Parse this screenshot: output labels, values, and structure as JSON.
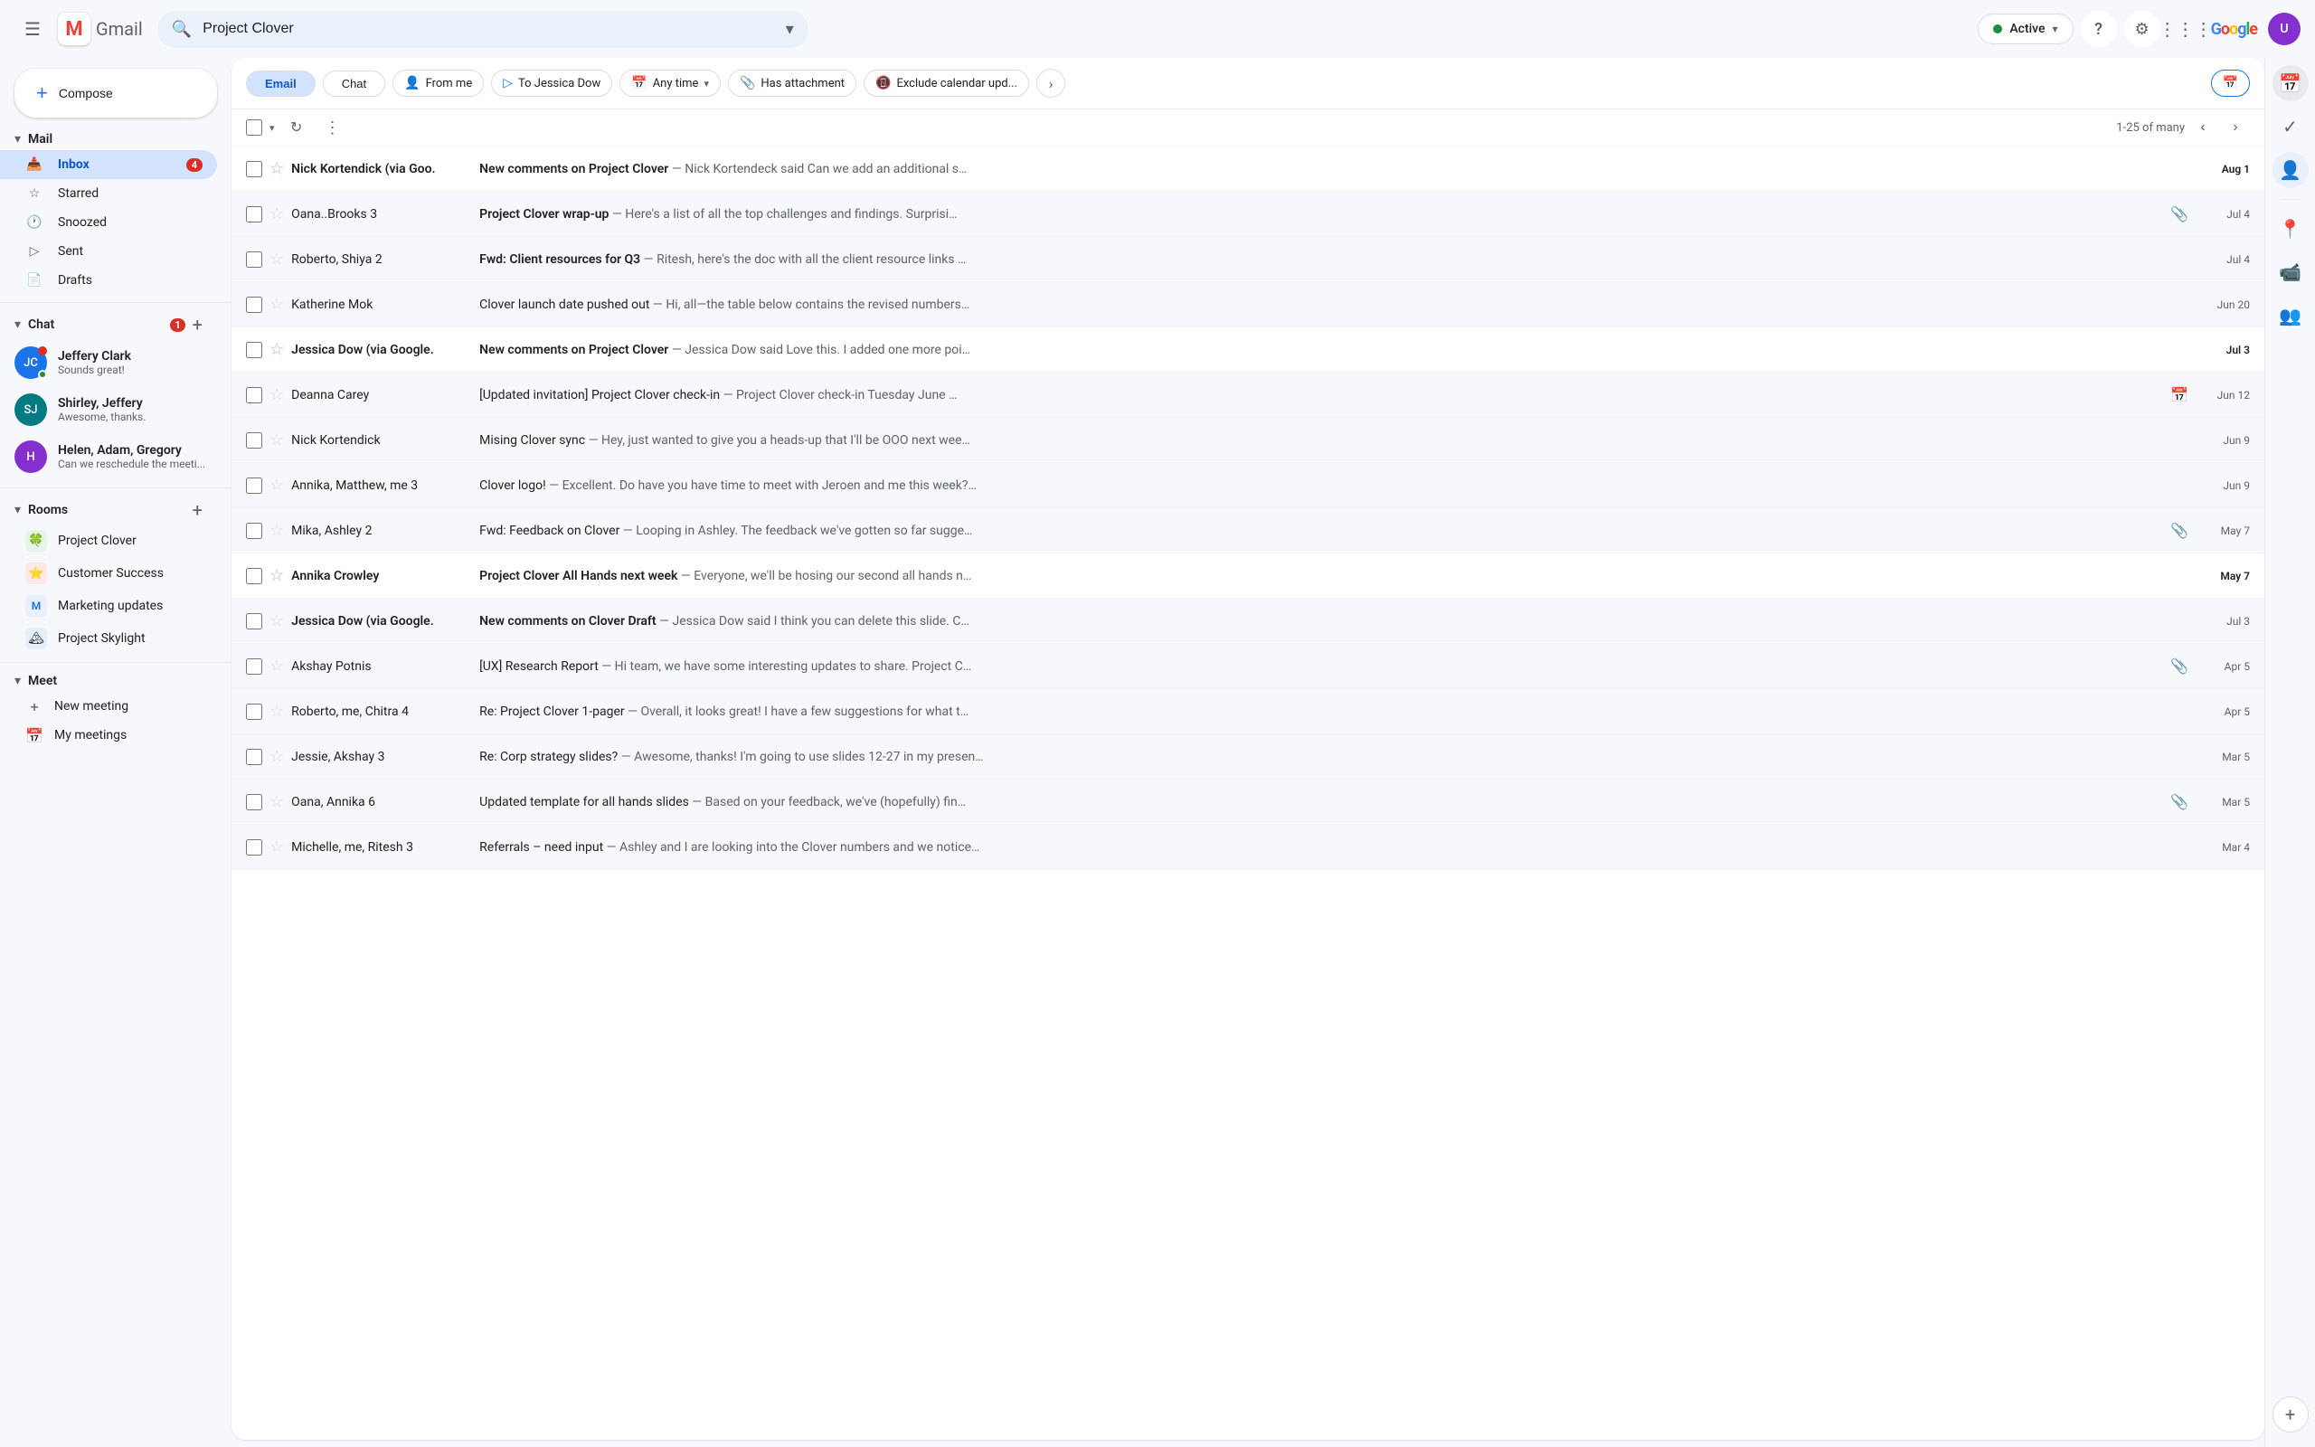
{
  "app": {
    "title": "Gmail",
    "logo_m": "M",
    "logo_text": "Gmail"
  },
  "topbar": {
    "search_placeholder": "Project Clover",
    "status_label": "Active",
    "help_icon": "?",
    "settings_icon": "⚙",
    "apps_icon": "⋮⋮⋮",
    "google_logo": "Google"
  },
  "compose": {
    "label": "Compose",
    "plus": "+"
  },
  "nav": {
    "mail_section": "Mail",
    "mail_items": [
      {
        "id": "inbox",
        "label": "Inbox",
        "badge": "4",
        "icon": "📥"
      },
      {
        "id": "starred",
        "label": "Starred",
        "badge": "",
        "icon": "☆"
      },
      {
        "id": "snoozed",
        "label": "Snoozed",
        "badge": "",
        "icon": "🕐"
      },
      {
        "id": "sent",
        "label": "Sent",
        "badge": "",
        "icon": "▷"
      },
      {
        "id": "drafts",
        "label": "Drafts",
        "badge": "",
        "icon": "📄"
      }
    ],
    "chat_section": "Chat",
    "chat_badge": "1",
    "chat_items": [
      {
        "id": "jeffery",
        "name": "Jeffery Clark",
        "preview": "Sounds great!",
        "online": true,
        "unread": true,
        "initials": "JC",
        "color": "av-blue"
      },
      {
        "id": "shirley",
        "name": "Shirley, Jeffery",
        "preview": "Awesome, thanks.",
        "online": false,
        "unread": false,
        "initials": "SJ",
        "color": "av-teal"
      },
      {
        "id": "helen",
        "name": "Helen, Adam, Gregory",
        "preview": "Can we reschedule the meeti...",
        "online": false,
        "unread": false,
        "initials": "H",
        "color": "av-purple"
      }
    ],
    "rooms_section": "Rooms",
    "rooms": [
      {
        "id": "project-clover",
        "label": "Project Clover",
        "emoji": "🍀"
      },
      {
        "id": "customer-success",
        "label": "Customer Success",
        "emoji": "⭐"
      },
      {
        "id": "marketing-updates",
        "label": "Marketing updates",
        "emoji": "M"
      },
      {
        "id": "project-skylight",
        "label": "Project Skylight",
        "emoji": "🏔"
      }
    ],
    "meet_section": "Meet",
    "meet_items": [
      {
        "id": "new-meeting",
        "label": "New meeting",
        "icon": "+"
      },
      {
        "id": "my-meetings",
        "label": "My meetings",
        "icon": "📅"
      }
    ]
  },
  "filter_bar": {
    "tab_email": "Email",
    "tab_chat": "Chat",
    "chip_from_me": "From me",
    "chip_to_jessica": "To Jessica Dow",
    "chip_any_time": "Any time",
    "chip_has_attachment": "Has attachment",
    "chip_exclude_calendar": "Exclude calendar upd..."
  },
  "toolbar": {
    "pagination": "1-25 of many"
  },
  "emails": [
    {
      "id": 1,
      "sender": "Nick Kortendick (via Goo.",
      "subject": "New comments on Project Clover",
      "preview": "— Nick Kortendeck said Can we add an additional s…",
      "date": "Aug 1",
      "unread": true,
      "starred": false,
      "has_attachment": false,
      "has_calendar": false
    },
    {
      "id": 2,
      "sender": "Oana..Brooks 3",
      "subject": "Project Clover wrap-up",
      "preview": "— Here's a list of all the top challenges and findings. Surprisi…",
      "date": "Jul 4",
      "unread": false,
      "starred": false,
      "has_attachment": true,
      "has_calendar": false
    },
    {
      "id": 3,
      "sender": "Roberto, Shiya 2",
      "subject": "Fwd: Client resources for Q3",
      "preview": "— Ritesh, here's the doc with all the client resource links …",
      "date": "Jul 4",
      "unread": false,
      "starred": false,
      "has_attachment": false,
      "has_calendar": false
    },
    {
      "id": 4,
      "sender": "Katherine Mok",
      "subject": "Clover launch date pushed out",
      "preview": "— Hi, all—the table below contains the revised numbers…",
      "date": "Jun 20",
      "unread": false,
      "starred": false,
      "has_attachment": false,
      "has_calendar": false
    },
    {
      "id": 5,
      "sender": "Jessica Dow (via Google.",
      "subject": "New comments on Project Clover",
      "preview": "— Jessica Dow said Love this. I added one more poi…",
      "date": "Jul 3",
      "unread": true,
      "starred": false,
      "has_attachment": false,
      "has_calendar": false
    },
    {
      "id": 6,
      "sender": "Deanna Carey",
      "subject": "[Updated invitation] Project Clover check-in",
      "preview": "— Project Clover check-in Tuesday June …",
      "date": "Jun 12",
      "unread": false,
      "starred": false,
      "has_attachment": false,
      "has_calendar": true
    },
    {
      "id": 7,
      "sender": "Nick Kortendick",
      "subject": "Mising Clover sync",
      "preview": "— Hey, just wanted to give you a heads-up that I'll be OOO next wee…",
      "date": "Jun 9",
      "unread": false,
      "starred": false,
      "has_attachment": false,
      "has_calendar": false
    },
    {
      "id": 8,
      "sender": "Annika, Matthew, me 3",
      "subject": "Clover logo!",
      "preview": "— Excellent. Do have you have time to meet with Jeroen and me this week?…",
      "date": "Jun 9",
      "unread": false,
      "starred": false,
      "has_attachment": false,
      "has_calendar": false
    },
    {
      "id": 9,
      "sender": "Mika, Ashley 2",
      "subject": "Fwd: Feedback on Clover",
      "preview": "— Looping in Ashley. The feedback we've gotten so far sugge…",
      "date": "May 7",
      "unread": false,
      "starred": false,
      "has_attachment": true,
      "has_calendar": false
    },
    {
      "id": 10,
      "sender": "Annika Crowley",
      "subject": "Project Clover All Hands next week",
      "preview": "— Everyone, we'll be hosing our second all hands n…",
      "date": "May 7",
      "unread": true,
      "starred": false,
      "has_attachment": false,
      "has_calendar": false
    },
    {
      "id": 11,
      "sender": "Jessica Dow (via Google.",
      "subject": "New comments on Clover Draft",
      "preview": "— Jessica Dow said I think you can delete this slide. C…",
      "date": "Jul 3",
      "unread": false,
      "starred": false,
      "has_attachment": false,
      "has_calendar": false
    },
    {
      "id": 12,
      "sender": "Akshay Potnis",
      "subject": "[UX] Research Report",
      "preview": "— Hi team, we have some interesting updates to share. Project C…",
      "date": "Apr 5",
      "unread": false,
      "starred": false,
      "has_attachment": true,
      "has_calendar": false
    },
    {
      "id": 13,
      "sender": "Roberto, me, Chitra 4",
      "subject": "Re: Project Clover 1-pager",
      "preview": "— Overall, it looks great! I have a few suggestions for what t…",
      "date": "Apr 5",
      "unread": false,
      "starred": false,
      "has_attachment": false,
      "has_calendar": false
    },
    {
      "id": 14,
      "sender": "Jessie, Akshay 3",
      "subject": "Re: Corp strategy slides?",
      "preview": "— Awesome, thanks! I'm going to use slides 12-27 in my presen…",
      "date": "Mar 5",
      "unread": false,
      "starred": false,
      "has_attachment": false,
      "has_calendar": false
    },
    {
      "id": 15,
      "sender": "Oana, Annika 6",
      "subject": "Updated template for all hands slides",
      "preview": "— Based on your feedback, we've (hopefully) fin…",
      "date": "Mar 5",
      "unread": false,
      "starred": false,
      "has_attachment": true,
      "has_calendar": false
    },
    {
      "id": 16,
      "sender": "Michelle, me, Ritesh 3",
      "subject": "Referrals – need input",
      "preview": "— Ashley and I are looking into the Clover numbers and we notice…",
      "date": "Mar 4",
      "unread": false,
      "starred": false,
      "has_attachment": false,
      "has_calendar": false
    }
  ],
  "right_sidebar": {
    "calendar_icon": "📅",
    "task_icon": "✓",
    "contacts_icon": "👤",
    "maps_icon": "📍",
    "meet_icon": "📹",
    "people_icon": "👥",
    "add_icon": "+"
  }
}
